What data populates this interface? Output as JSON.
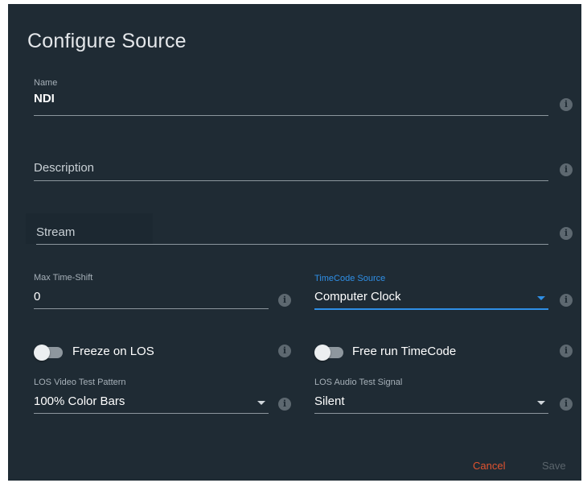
{
  "dialog": {
    "title": "Configure Source"
  },
  "fields": {
    "name": {
      "label": "Name",
      "value": "NDI"
    },
    "description": {
      "placeholder": "Description"
    },
    "stream": {
      "placeholder": "Stream"
    },
    "max_time_shift": {
      "label": "Max Time-Shift",
      "value": "0"
    },
    "timecode_source": {
      "label": "TimeCode Source",
      "value": "Computer Clock"
    },
    "los_video_test_pattern": {
      "label": "LOS Video Test Pattern",
      "value": "100% Color Bars"
    },
    "los_audio_test_signal": {
      "label": "LOS Audio Test Signal",
      "value": "Silent"
    }
  },
  "toggles": {
    "freeze_on_los": {
      "label": "Freeze on LOS",
      "on": false
    },
    "free_run_timecode": {
      "label": "Free run TimeCode",
      "on": false
    }
  },
  "info_glyph": "i",
  "actions": {
    "cancel": "Cancel",
    "save": "Save"
  },
  "colors": {
    "dialog_background": "#1f2b34",
    "accent": "#2f8fe6",
    "cancel": "#e0532f",
    "disabled": "#5b656c"
  },
  "icons": [
    "info-icon",
    "dropdown-caret-icon"
  ]
}
